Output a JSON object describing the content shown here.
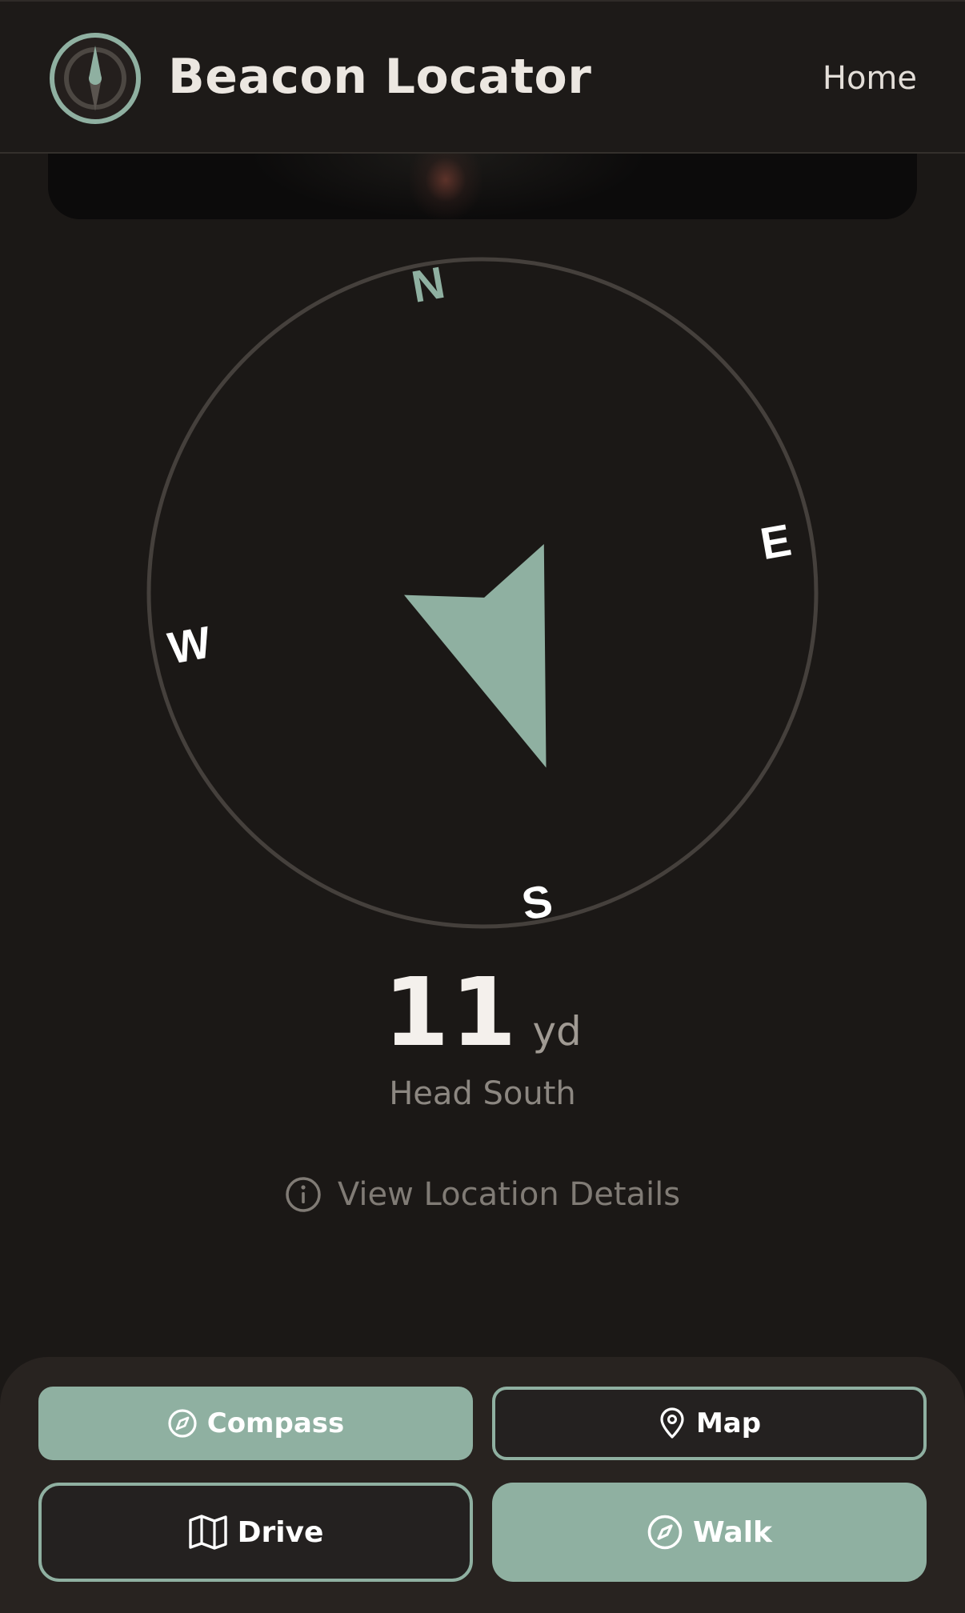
{
  "header": {
    "app_title": "Beacon Locator",
    "home_label": "Home"
  },
  "compass": {
    "labels": {
      "north": "N",
      "east": "E",
      "south": "S",
      "west": "W"
    },
    "dial_rotation_deg": -10,
    "arrow_heading_deg": 160
  },
  "distance": {
    "value": "11",
    "unit": "yd",
    "direction_hint": "Head South"
  },
  "details_link": {
    "label": "View Location Details",
    "icon": "info-circle-icon"
  },
  "view_modes": [
    {
      "label": "Compass",
      "icon": "compass-icon",
      "selected": true
    },
    {
      "label": "Map",
      "icon": "map-pin-icon",
      "selected": false
    }
  ],
  "travel_modes": [
    {
      "label": "Drive",
      "icon": "map-icon",
      "selected": false
    },
    {
      "label": "Walk",
      "icon": "compass-icon",
      "selected": true
    }
  ],
  "colors": {
    "accent": "#8fb0a1",
    "background": "#1b1816",
    "panel": "#282320",
    "text_primary": "#f4f0ec",
    "text_muted": "#8c8781"
  }
}
